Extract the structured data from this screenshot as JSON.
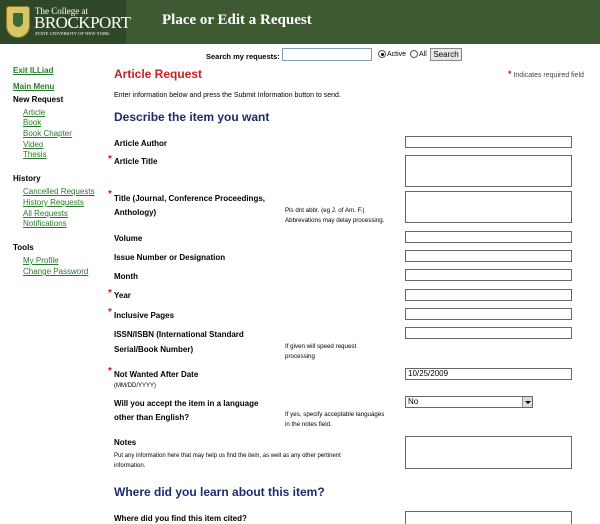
{
  "header": {
    "logo_line1": "The College at",
    "logo_line2": "BROCKPORT",
    "logo_line3": "STATE UNIVERSITY OF NEW YORK",
    "page_title": "Place or Edit a Request"
  },
  "search": {
    "label": "Search my requests:",
    "value": "",
    "option_active": "Active",
    "option_all": "All",
    "selected": "Active",
    "button": "Search"
  },
  "sidebar": {
    "exit": "Exit ILLiad",
    "main_menu": "Main Menu",
    "new_request_heading": "New Request",
    "new_request_items": [
      "Article",
      "Book",
      "Book Chapter",
      "Video",
      "Thesis"
    ],
    "history_heading": "History",
    "history_items": [
      "Cancelled Requests",
      "History Requests",
      "All Requests",
      "Notifications"
    ],
    "tools_heading": "Tools",
    "tools_items": [
      "My Profile",
      "Change Password"
    ]
  },
  "form": {
    "title": "Article Request",
    "required_note": "Indicates required field",
    "required_marker": "*",
    "instructions": "Enter information below and press the Submit Information button to send.",
    "section1": "Describe the item you want",
    "fields": {
      "author": "Article Author",
      "article_title": "Article Title",
      "journal_title_l1": "Title (Journal, Conference Proceedings,",
      "journal_title_l2": "Anthology)",
      "journal_hint_l1": "Pls dnt abbr. (eg J. of Am. F.)",
      "journal_hint_l2": "Abbrevations may delay processing.",
      "volume": "Volume",
      "issue": "Issue Number or Designation",
      "month": "Month",
      "year": "Year",
      "pages": "Inclusive Pages",
      "issn_l1": "ISSN/ISBN (International Standard",
      "issn_l2": "Serial/Book Number)",
      "issn_hint_l1": "If given will speed request",
      "issn_hint_l2": "processing",
      "not_wanted": "Not Wanted After Date",
      "not_wanted_format": "(MM/DD/YYYY)",
      "not_wanted_value": "10/25/2009",
      "language_l1": "Will you accept the item in a language",
      "language_l2": "other than English?",
      "language_hint_l1": "If yes, specify acceptable languages",
      "language_hint_l2": "in the notes field.",
      "language_value": "No",
      "notes": "Notes",
      "notes_hint_l1": "Put any information here that may help us find the item, as well as any other pertinent",
      "notes_hint_l2": "information."
    },
    "section2": "Where did you learn about this item?",
    "cited_label": "Where did you find this item cited?"
  }
}
